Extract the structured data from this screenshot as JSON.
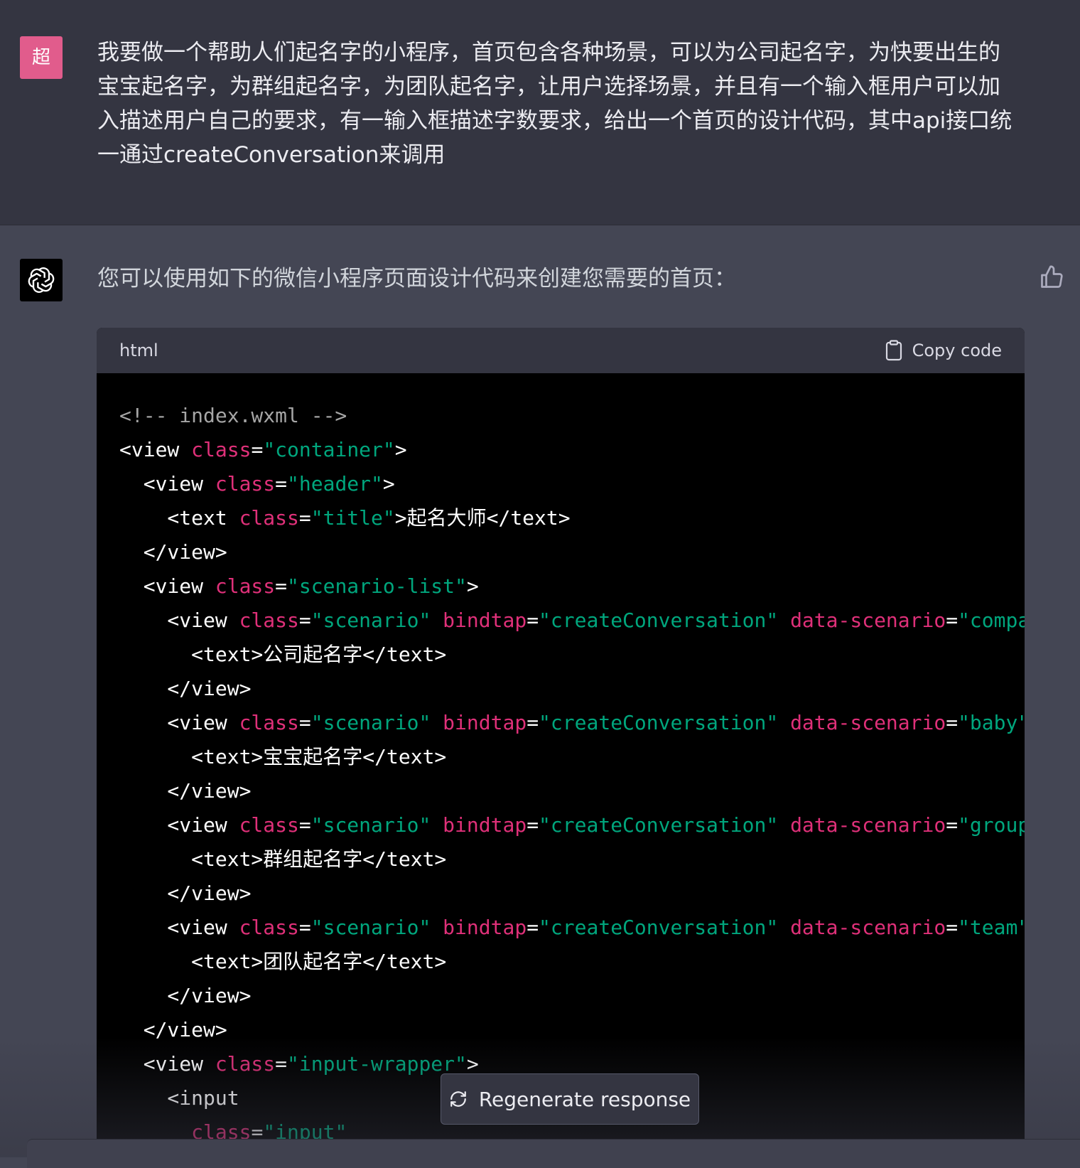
{
  "user": {
    "avatar_letter": "超",
    "avatar_color": "#e15c8c",
    "message": "我要做一个帮助人们起名字的小程序，首页包含各种场景，可以为公司起名字，为快要出生的宝宝起名字，为群组起名字，为团队起名字，让用户选择场景，并且有一个输入框用户可以加入描述用户自己的要求，有一输入框描述字数要求，给出一个首页的设计代码，其中api接口统一通过createConversation来调用"
  },
  "assistant": {
    "avatar_icon": "openai-logo-icon",
    "intro": "您可以使用如下的微信小程序页面设计代码来创建您需要的首页：",
    "feedback_icon": "thumbs-up-icon"
  },
  "code_block": {
    "language": "html",
    "copy_label": "Copy code",
    "copy_icon": "clipboard-icon",
    "lines": [
      [
        {
          "t": "c",
          "v": "<!-- index.wxml -->"
        }
      ],
      [
        {
          "t": "p",
          "v": "<view "
        },
        {
          "t": "a",
          "v": "class"
        },
        {
          "t": "p",
          "v": "="
        },
        {
          "t": "s",
          "v": "\"container\""
        },
        {
          "t": "p",
          "v": ">"
        }
      ],
      [
        {
          "t": "p",
          "v": "  <view "
        },
        {
          "t": "a",
          "v": "class"
        },
        {
          "t": "p",
          "v": "="
        },
        {
          "t": "s",
          "v": "\"header\""
        },
        {
          "t": "p",
          "v": ">"
        }
      ],
      [
        {
          "t": "p",
          "v": "    <text "
        },
        {
          "t": "a",
          "v": "class"
        },
        {
          "t": "p",
          "v": "="
        },
        {
          "t": "s",
          "v": "\"title\""
        },
        {
          "t": "p",
          "v": ">起名大师</text>"
        }
      ],
      [
        {
          "t": "p",
          "v": "  </view>"
        }
      ],
      [
        {
          "t": "p",
          "v": "  <view "
        },
        {
          "t": "a",
          "v": "class"
        },
        {
          "t": "p",
          "v": "="
        },
        {
          "t": "s",
          "v": "\"scenario-list\""
        },
        {
          "t": "p",
          "v": ">"
        }
      ],
      [
        {
          "t": "p",
          "v": "    <view "
        },
        {
          "t": "a",
          "v": "class"
        },
        {
          "t": "p",
          "v": "="
        },
        {
          "t": "s",
          "v": "\"scenario\""
        },
        {
          "t": "p",
          "v": " "
        },
        {
          "t": "a",
          "v": "bindtap"
        },
        {
          "t": "p",
          "v": "="
        },
        {
          "t": "s",
          "v": "\"createConversation\""
        },
        {
          "t": "p",
          "v": " "
        },
        {
          "t": "a",
          "v": "data-scenario"
        },
        {
          "t": "p",
          "v": "="
        },
        {
          "t": "s",
          "v": "\"compa"
        }
      ],
      [
        {
          "t": "p",
          "v": "      <text>公司起名字</text>"
        }
      ],
      [
        {
          "t": "p",
          "v": "    </view>"
        }
      ],
      [
        {
          "t": "p",
          "v": "    <view "
        },
        {
          "t": "a",
          "v": "class"
        },
        {
          "t": "p",
          "v": "="
        },
        {
          "t": "s",
          "v": "\"scenario\""
        },
        {
          "t": "p",
          "v": " "
        },
        {
          "t": "a",
          "v": "bindtap"
        },
        {
          "t": "p",
          "v": "="
        },
        {
          "t": "s",
          "v": "\"createConversation\""
        },
        {
          "t": "p",
          "v": " "
        },
        {
          "t": "a",
          "v": "data-scenario"
        },
        {
          "t": "p",
          "v": "="
        },
        {
          "t": "s",
          "v": "\"baby\""
        }
      ],
      [
        {
          "t": "p",
          "v": "      <text>宝宝起名字</text>"
        }
      ],
      [
        {
          "t": "p",
          "v": "    </view>"
        }
      ],
      [
        {
          "t": "p",
          "v": "    <view "
        },
        {
          "t": "a",
          "v": "class"
        },
        {
          "t": "p",
          "v": "="
        },
        {
          "t": "s",
          "v": "\"scenario\""
        },
        {
          "t": "p",
          "v": " "
        },
        {
          "t": "a",
          "v": "bindtap"
        },
        {
          "t": "p",
          "v": "="
        },
        {
          "t": "s",
          "v": "\"createConversation\""
        },
        {
          "t": "p",
          "v": " "
        },
        {
          "t": "a",
          "v": "data-scenario"
        },
        {
          "t": "p",
          "v": "="
        },
        {
          "t": "s",
          "v": "\"group"
        }
      ],
      [
        {
          "t": "p",
          "v": "      <text>群组起名字</text>"
        }
      ],
      [
        {
          "t": "p",
          "v": "    </view>"
        }
      ],
      [
        {
          "t": "p",
          "v": "    <view "
        },
        {
          "t": "a",
          "v": "class"
        },
        {
          "t": "p",
          "v": "="
        },
        {
          "t": "s",
          "v": "\"scenario\""
        },
        {
          "t": "p",
          "v": " "
        },
        {
          "t": "a",
          "v": "bindtap"
        },
        {
          "t": "p",
          "v": "="
        },
        {
          "t": "s",
          "v": "\"createConversation\""
        },
        {
          "t": "p",
          "v": " "
        },
        {
          "t": "a",
          "v": "data-scenario"
        },
        {
          "t": "p",
          "v": "="
        },
        {
          "t": "s",
          "v": "\"team\""
        }
      ],
      [
        {
          "t": "p",
          "v": "      <text>团队起名字</text>"
        }
      ],
      [
        {
          "t": "p",
          "v": "    </view>"
        }
      ],
      [
        {
          "t": "p",
          "v": "  </view>"
        }
      ],
      [
        {
          "t": "p",
          "v": "  <view "
        },
        {
          "t": "a",
          "v": "class"
        },
        {
          "t": "p",
          "v": "="
        },
        {
          "t": "s",
          "v": "\"input-wrapper\""
        },
        {
          "t": "p",
          "v": ">"
        }
      ],
      [
        {
          "t": "p",
          "v": "    <input"
        }
      ],
      [
        {
          "t": "p",
          "v": "      "
        },
        {
          "t": "a",
          "v": "class"
        },
        {
          "t": "p",
          "v": "="
        },
        {
          "t": "s",
          "v": "\"input\""
        }
      ]
    ]
  },
  "regenerate": {
    "label": "Regenerate response",
    "icon": "refresh-icon"
  }
}
